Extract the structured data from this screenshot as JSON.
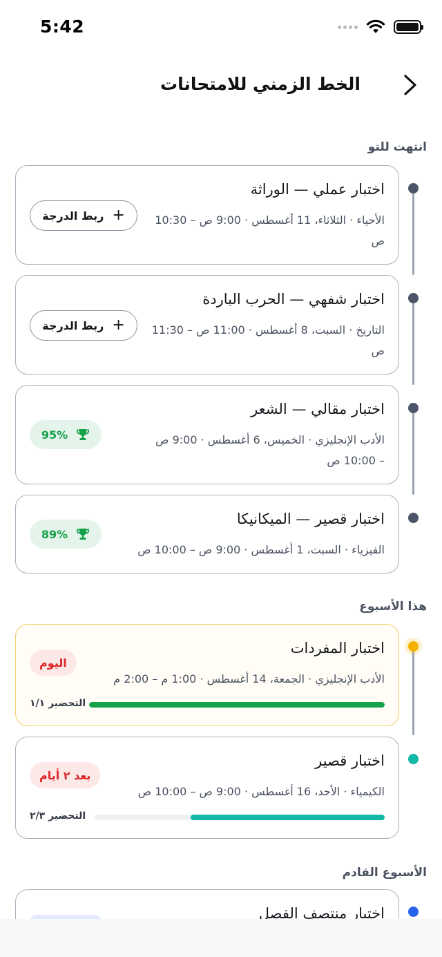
{
  "status": {
    "time": "5:42"
  },
  "header": {
    "title": "الخط الزمني للامتحانات"
  },
  "sections": {
    "just_ended": "انتهت للتو",
    "this_week": "هذا الأسبوع",
    "next_week": "الأسبوع القادم"
  },
  "ended": [
    {
      "title": "اختبار عملي — الوراثة",
      "meta": "الأحياء · الثلاثاء، 11 أغسطس · 9:00 ص – 10:30 ص",
      "action": "ربط الدرجة"
    },
    {
      "title": "اختبار شفهي — الحرب الباردة",
      "meta": "التاريخ · السبت، 8 أغسطس · 11:00 ص – 11:30 ص",
      "action": "ربط الدرجة"
    },
    {
      "title": "اختبار مقالي — الشعر",
      "meta": "الأدب الإنجليزي · الخميس، 6 أغسطس · 9:00 ص – 10:00 ص",
      "score": "95%"
    },
    {
      "title": "اختبار قصير — الميكانيكا",
      "meta": "الفيزياء · السبت، 1 أغسطس · 9:00 ص – 10:00 ص",
      "score": "89%"
    }
  ],
  "week": [
    {
      "title": "اختبار المفردات",
      "meta": "الأدب الإنجليزي · الجمعة، 14 أغسطس · 1:00 م – 2:00 م",
      "badge": "اليوم",
      "prep_label": "التحضير ١/١",
      "prep_fraction": 1.0
    },
    {
      "title": "اختبار قصير",
      "meta": "الكيمياء · الأحد، 16 أغسطس · 9:00 ص – 10:00 ص",
      "badge": "بعد ٢ أيام",
      "prep_label": "التحضير ٢/٣",
      "prep_fraction": 0.67
    }
  ],
  "next": [
    {
      "title": "اختبار منتصف الفصل"
    }
  ],
  "colors": {
    "accent_green": "#16a34a",
    "accent_teal": "#14b8a6",
    "today_dot": "#f5b100",
    "danger": "#dc2626"
  }
}
